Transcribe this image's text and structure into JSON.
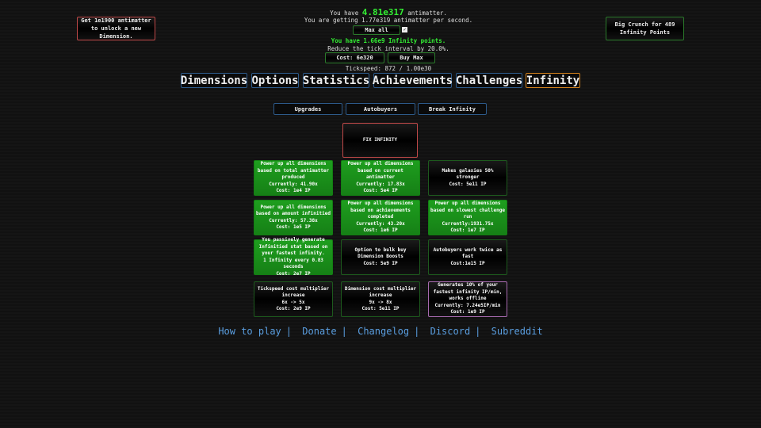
{
  "header": {
    "am_prefix": "You have",
    "antimatter": "4.81e317",
    "am_suffix": "antimatter.",
    "rate": "You are getting 1.77e319 antimatter per second.",
    "max_all": "Max all",
    "max_all_checked": true,
    "ip_text": "You have 1.66e9 Infinity points.",
    "tick_reduce": "Reduce the tick interval by 20.0%.",
    "tick_cost": "Cost: 6e320",
    "buy_max": "Buy Max",
    "tickspeed": "Tickspeed: 872 / 1.00e30"
  },
  "dim_unlock": "Get 1e1900 antimatter to unlock a new Dimension.",
  "big_crunch": "Big Crunch for 489 Infinity Points",
  "tabs": [
    "Dimensions",
    "Options",
    "Statistics",
    "Achievements",
    "Challenges",
    "Infinity"
  ],
  "active_tab": "Infinity",
  "subtabs": [
    "Upgrades",
    "Autobuyers",
    "Break Infinity"
  ],
  "fix_infinity": "FIX INFINITY",
  "upgrades": [
    "Power up all dimensions based on total antimatter produced\nCurrently: 41.90x\nCost: 1e4 IP",
    "Power up all dimensions based on current antimatter\nCurrently: 17.83x\nCost: 5e4 IP",
    "Makes galaxies 50% stronger\nCost: 5e11 IP",
    "Power up all dimensions based on amount infinitied\nCurrently: 57.38x\nCost: 1e5 IP",
    "Power up all dimensions based on achievements completed\nCurrently: 43.20x\nCost: 1e6 IP",
    "Power up all dimensions based on slowest challenge run\nCurrently:1931.75x\nCost: 1e7 IP",
    "You passively generate Infinitied stat based on your fastest infinity.\n1 Infinity every 0.83 seconds\nCost: 2e7 IP",
    "Option to bulk buy Dimension Boosts\nCost: 5e9 IP",
    "Autobuyers work twice as fast\nCost:1e15 IP",
    "Tickspeed cost multiplier increase\n6x -> 5x\nCost: 2e9 IP",
    "Dimension cost multiplier increase\n9x -> 8x\nCost: 5e11 IP",
    "Generates 10% of your fastest infinity IP/min, works offline\nCurrently: 7.24e5IP/min\nCost: 1e9 IP"
  ],
  "upgrade_states": [
    "bought",
    "bought",
    "avail",
    "bought",
    "bought",
    "bought",
    "bought",
    "avail",
    "avail",
    "avail",
    "avail",
    "purple"
  ],
  "footer": [
    "How to play",
    "Donate",
    "Changelog",
    "Discord",
    "Subreddit"
  ],
  "colors": {
    "accent_green": "#22ee22",
    "tab_border": "#2d5a8a",
    "active_tab": "#d0801c",
    "link": "#5a9ee0"
  }
}
